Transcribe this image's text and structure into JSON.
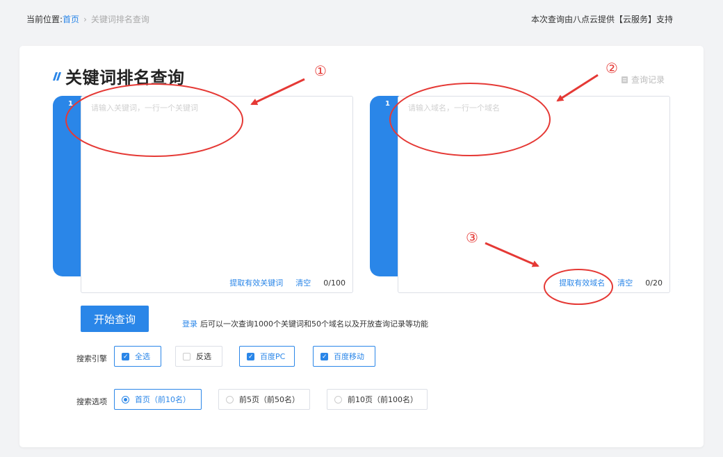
{
  "breadcrumb": {
    "label": "当前位置:",
    "home": "首页",
    "current": "关键词排名查询"
  },
  "provider_text": "本次查询由八点云提供【云服务】支持",
  "page_title": "关键词排名查询",
  "history_label": "查询记录",
  "keyword_editor": {
    "line_number": "1",
    "placeholder": "请输入关键词，一行一个关键词",
    "extract_label": "提取有效关键词",
    "clear_label": "清空",
    "count": "0/100"
  },
  "domain_editor": {
    "line_number": "1",
    "placeholder": "请输入域名，一行一个域名",
    "extract_label": "提取有效域名",
    "clear_label": "清空",
    "count": "0/20"
  },
  "start_button": "开始查询",
  "login_tip": {
    "link": "登录",
    "text": "后可以一次查询1000个关键词和50个域名以及开放查询记录等功能"
  },
  "search_engine": {
    "label": "搜索引擎",
    "options": [
      {
        "label": "全选",
        "checked": true
      },
      {
        "label": "反选",
        "checked": false
      },
      {
        "label": "百度PC",
        "checked": true
      },
      {
        "label": "百度移动",
        "checked": true
      }
    ]
  },
  "search_options": {
    "label": "搜索选项",
    "options": [
      {
        "label": "首页（前10名）",
        "selected": true
      },
      {
        "label": "前5页（前50名）",
        "selected": false
      },
      {
        "label": "前10页（前100名）",
        "selected": false
      }
    ]
  },
  "annotations": [
    "①",
    "②",
    "③"
  ],
  "colors": {
    "accent": "#2a86e8",
    "annotation": "#e53935"
  }
}
